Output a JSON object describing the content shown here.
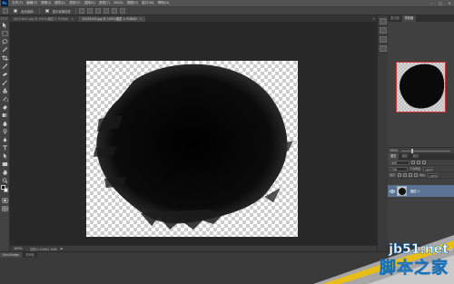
{
  "app": {
    "logo": "Ps",
    "menu": [
      "文件(F)",
      "编辑(E)",
      "图像(I)",
      "图层(L)",
      "类型(Y)",
      "选择(S)",
      "滤镜(T)",
      "3D(D)",
      "视图(V)",
      "窗口(W)",
      "帮助(H)"
    ],
    "window_controls": [
      "–",
      "□",
      "✕"
    ]
  },
  "options_bar": {
    "auto_select_label": "自动选择:",
    "show_transform_label": "显示变换控件"
  },
  "tabs": [
    {
      "label": "0b151b22.jpg @ 100%(图层 0, RGB/8)",
      "active": false
    },
    {
      "label": "20150125.jpg @ 100%(图层 1, RGB/8)",
      "active": true
    }
  ],
  "status": {
    "zoom": "100%",
    "doc_info": "文档:1.01M/1.34M"
  },
  "bottom_panel": {
    "tabs": [
      "Mini Bridge",
      "时间轴"
    ]
  },
  "right_panels": {
    "top_tabs": [
      "直方图",
      "导航器"
    ],
    "nav_zoom": "100%",
    "layers_tabs": [
      "图层",
      "通道",
      "路径"
    ],
    "kind_label": "类型",
    "blend_mode": "正常",
    "opacity_label": "不透明度:",
    "opacity_value": "100%",
    "lock_label": "锁定:",
    "fill_label": "填充:",
    "fill_value": "100%",
    "layer_name": "图层 1"
  },
  "colors": {
    "foreground": "#000000",
    "background": "#ffffff",
    "layer_selected": "#5a7394"
  },
  "watermark": {
    "url": "jb51.net",
    "site": "脚本之家"
  }
}
